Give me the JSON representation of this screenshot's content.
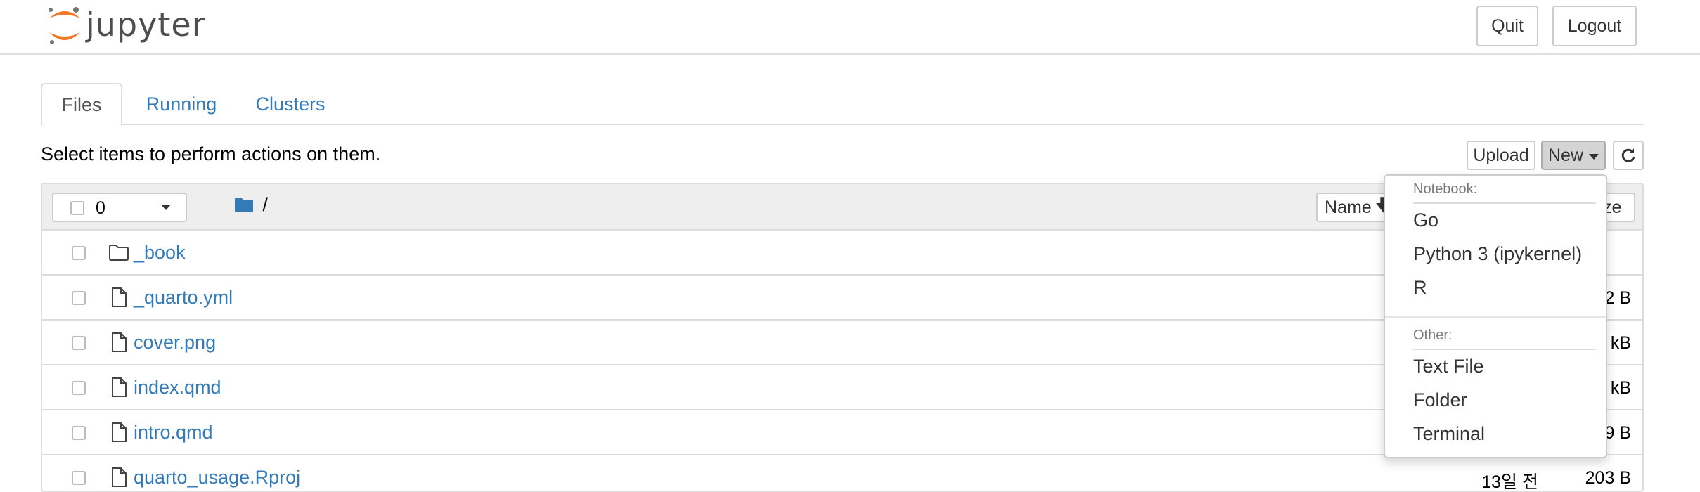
{
  "header": {
    "brand": "jupyter",
    "quit_label": "Quit",
    "logout_label": "Logout"
  },
  "tabs": [
    {
      "label": "Files",
      "active": true
    },
    {
      "label": "Running",
      "active": false
    },
    {
      "label": "Clusters",
      "active": false
    }
  ],
  "toolbar": {
    "hint": "Select items to perform actions on them.",
    "upload_label": "Upload",
    "new_label": "New",
    "refresh_icon": "refresh-icon"
  },
  "list_header": {
    "selected_count": "0",
    "path": "/",
    "sort_name_label": "Name",
    "sort_size_label": "ze"
  },
  "files": [
    {
      "name": "_book",
      "type": "folder",
      "date": "",
      "size": ""
    },
    {
      "name": "_quarto.yml",
      "type": "file",
      "date": "",
      "size": "2 B"
    },
    {
      "name": "cover.png",
      "type": "file",
      "date": "",
      "size": "kB"
    },
    {
      "name": "index.qmd",
      "type": "file",
      "date": "",
      "size": "kB"
    },
    {
      "name": "intro.qmd",
      "type": "file",
      "date": "",
      "size": "9 B"
    },
    {
      "name": "quarto_usage.Rproj",
      "type": "file",
      "date": "13일 전",
      "size": "203 B"
    }
  ],
  "new_menu": {
    "notebook_header": "Notebook:",
    "notebook_items": [
      "Go",
      "Python 3 (ipykernel)",
      "R"
    ],
    "other_header": "Other:",
    "other_items": [
      "Text File",
      "Folder",
      "Terminal"
    ]
  },
  "colors": {
    "link": "#337ab7",
    "logo_orange": "#f37726",
    "header_bg": "#eeeeee"
  }
}
